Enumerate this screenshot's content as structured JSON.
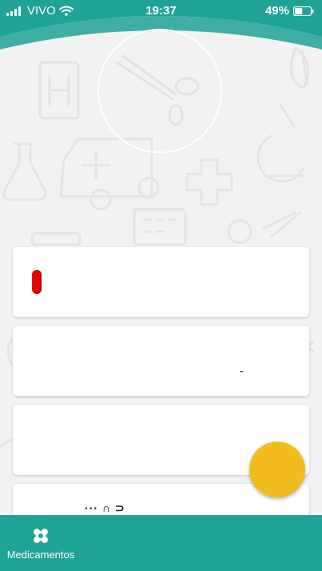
{
  "status_bar": {
    "carrier": "VIVO",
    "time": "19:37",
    "battery": "49%",
    "battery_level": 0.49
  },
  "colors": {
    "primary": "#1fa394",
    "fab": "#f2bc1f",
    "pill": "#e60000",
    "card": "#ffffff",
    "background": "#f2f2f2"
  },
  "cards": [
    {
      "icon": "pill-icon",
      "text": ""
    },
    {
      "text": "-"
    },
    {
      "text": ""
    },
    {
      "text": "··· ∩ ⊃"
    }
  ],
  "bottom_nav": {
    "items": [
      {
        "label": "Medicamentos",
        "icon": "bandage-icon"
      }
    ]
  }
}
